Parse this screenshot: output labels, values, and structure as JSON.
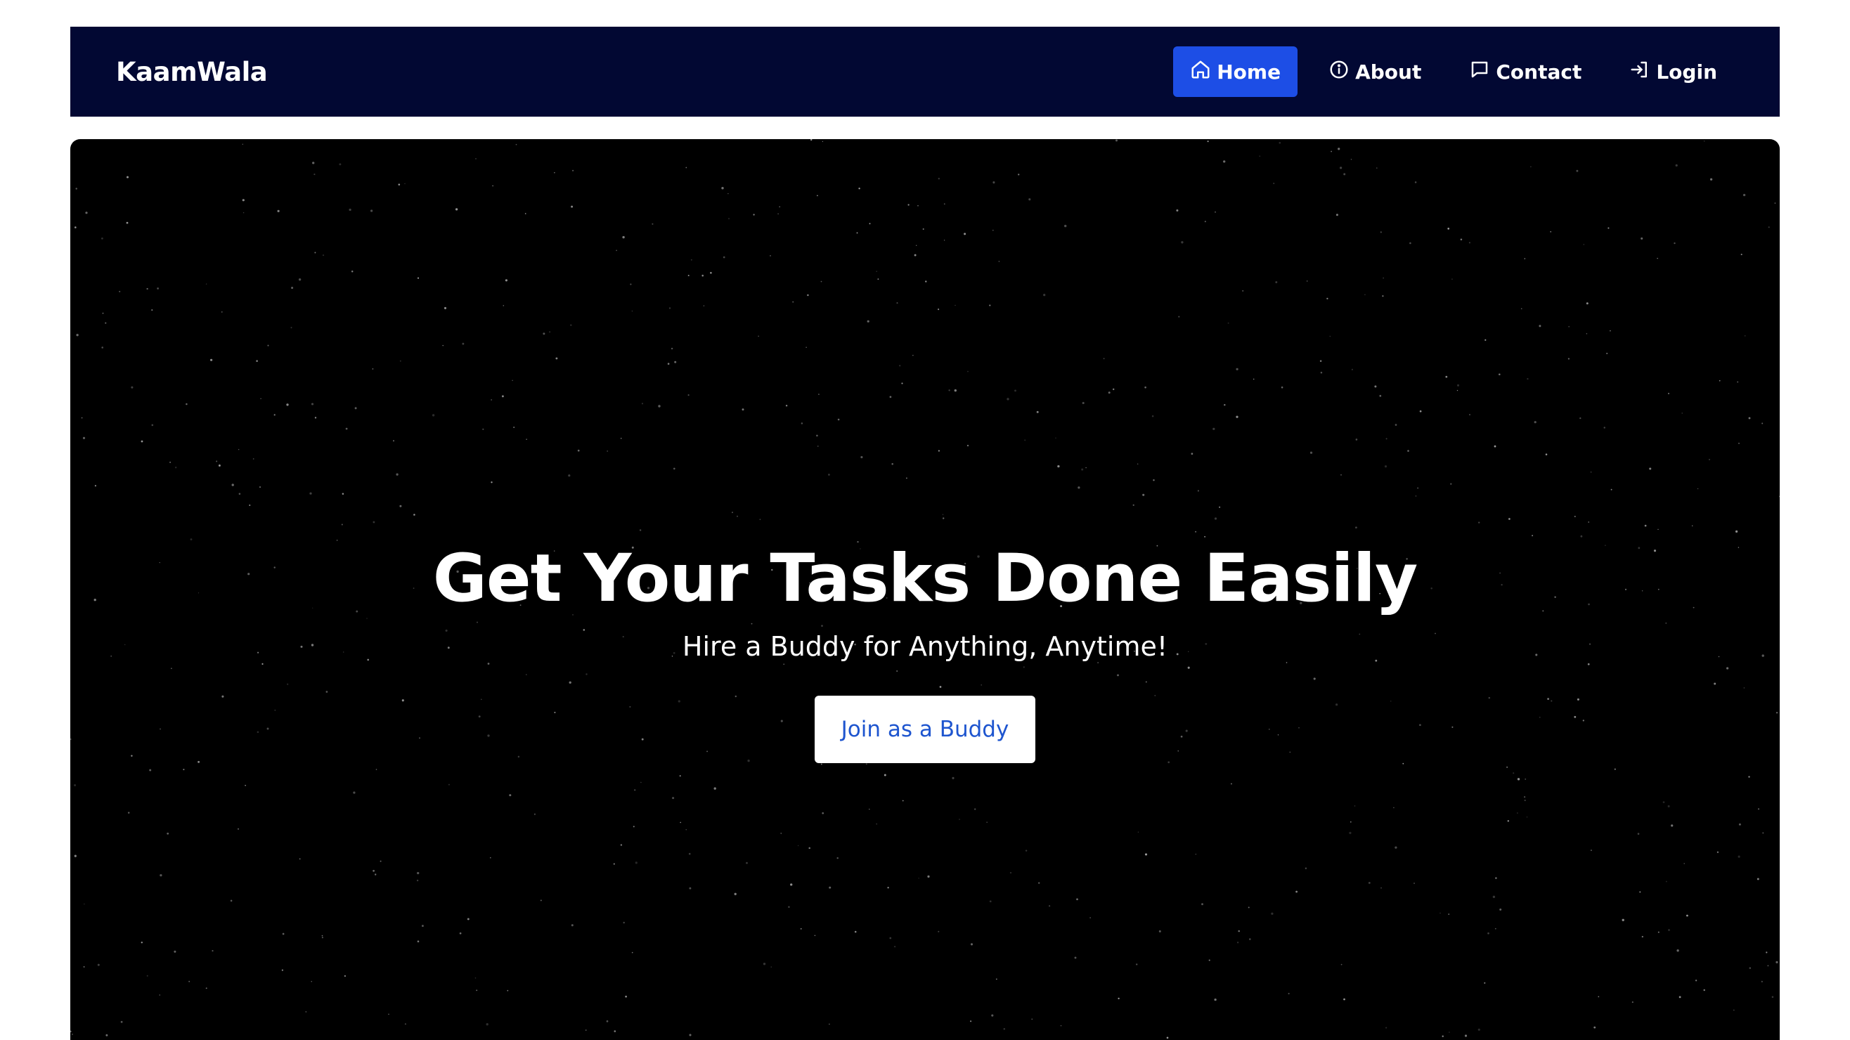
{
  "navbar": {
    "brand": "KaamWala",
    "items": [
      {
        "label": "Home",
        "icon": "home-icon",
        "active": true
      },
      {
        "label": "About",
        "icon": "info-icon",
        "active": false
      },
      {
        "label": "Contact",
        "icon": "message-icon",
        "active": false
      },
      {
        "label": "Login",
        "icon": "login-icon",
        "active": false
      }
    ]
  },
  "hero": {
    "title": "Get Your Tasks Done Easily",
    "subtitle": "Hire a Buddy for Anything, Anytime!",
    "cta_label": "Join as a Buddy"
  },
  "colors": {
    "navbar_bg": "#020833",
    "active_nav_bg": "#1d4ee6",
    "hero_bg": "#000000",
    "cta_text": "#1e55cf"
  }
}
